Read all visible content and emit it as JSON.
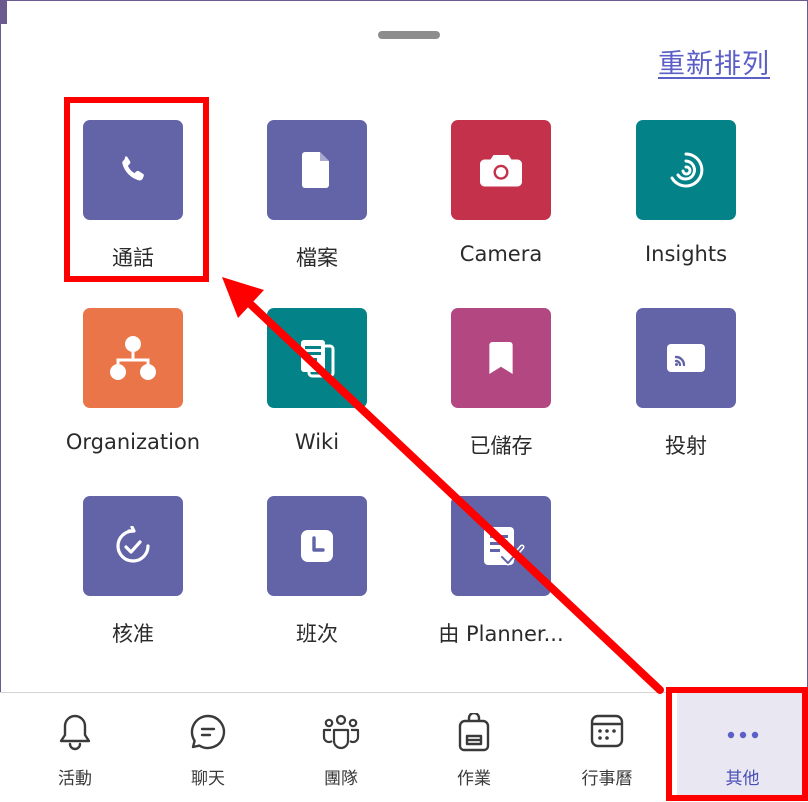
{
  "header": {
    "rearrange_label": "重新排列"
  },
  "apps": [
    {
      "label": "通話",
      "color": "#6264a7",
      "icon": "phone-icon"
    },
    {
      "label": "檔案",
      "color": "#6264a7",
      "icon": "file-icon"
    },
    {
      "label": "Camera",
      "color": "#c4314b",
      "icon": "camera-icon"
    },
    {
      "label": "Insights",
      "color": "#038387",
      "icon": "insights-icon"
    },
    {
      "label": "Organization",
      "color": "#e97548",
      "icon": "org-chart-icon"
    },
    {
      "label": "Wiki",
      "color": "#038387",
      "icon": "wiki-icon"
    },
    {
      "label": "已儲存",
      "color": "#b24782",
      "icon": "bookmark-icon"
    },
    {
      "label": "投射",
      "color": "#6264a7",
      "icon": "cast-icon"
    },
    {
      "label": "核准",
      "color": "#6264a7",
      "icon": "approval-icon"
    },
    {
      "label": "班次",
      "color": "#6264a7",
      "icon": "clock-icon"
    },
    {
      "label": "由 Planner...",
      "color": "#6264a7",
      "icon": "planner-icon"
    }
  ],
  "bottom_nav": [
    {
      "label": "活動",
      "icon": "bell-icon"
    },
    {
      "label": "聊天",
      "icon": "chat-icon"
    },
    {
      "label": "團隊",
      "icon": "teams-icon"
    },
    {
      "label": "作業",
      "icon": "backpack-icon"
    },
    {
      "label": "行事曆",
      "icon": "calendar-icon"
    },
    {
      "label": "其他",
      "icon": "more-icon",
      "selected": true
    }
  ],
  "annotation_color": "#ff0000",
  "accent_color": "#5b5fc7"
}
